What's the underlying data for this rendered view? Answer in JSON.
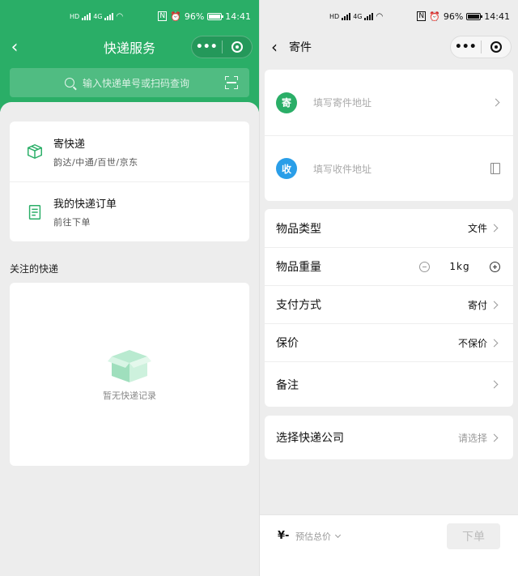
{
  "status_bar": {
    "battery": "96%",
    "time": "14:41",
    "network": "4G",
    "sim1": "HD",
    "sim2": "HD"
  },
  "left_screen": {
    "title": "快递服务",
    "search": {
      "placeholder": "输入快递单号或扫码查询"
    },
    "menu": [
      {
        "title": "寄快递",
        "subtitle": "韵达/中通/百世/京东",
        "icon": "box-icon"
      },
      {
        "title": "我的快递订单",
        "subtitle": "前往下单",
        "icon": "document-icon"
      }
    ],
    "followed_label": "关注的快递",
    "empty_text": "暂无快递记录"
  },
  "right_screen": {
    "title": "寄件",
    "sender": {
      "badge": "寄",
      "placeholder": "填写寄件地址",
      "color": "#2aae67"
    },
    "receiver": {
      "badge": "收",
      "placeholder": "填写收件地址",
      "color": "#2a9ee8"
    },
    "details": [
      {
        "label": "物品类型",
        "value": "文件"
      },
      {
        "label": "物品重量",
        "value": "1kg"
      },
      {
        "label": "支付方式",
        "value": "寄付"
      },
      {
        "label": "保价",
        "value": "不保价"
      },
      {
        "label": "备注",
        "value": ""
      }
    ],
    "company": {
      "label": "选择快递公司",
      "value": "请选择"
    },
    "footer": {
      "price": "¥-",
      "estimate_label": "预估总价",
      "order_button": "下单"
    }
  },
  "colors": {
    "brand_green": "#2aae67",
    "receiver_blue": "#2a9ee8"
  }
}
